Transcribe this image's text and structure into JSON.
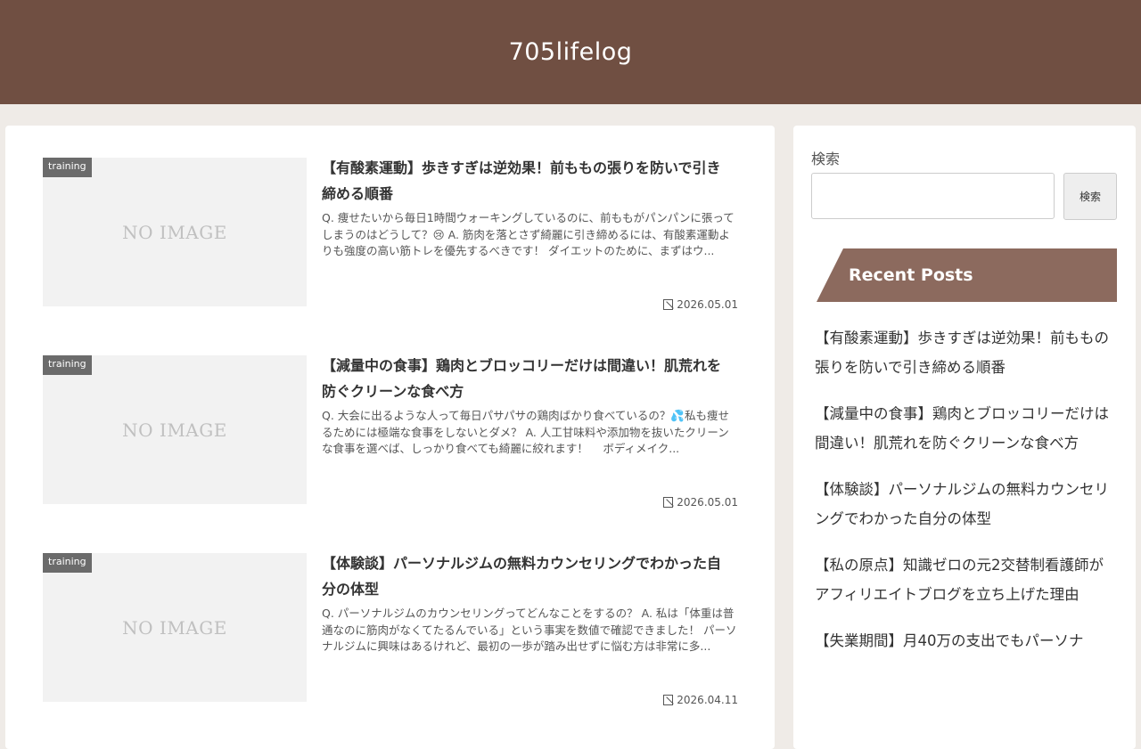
{
  "site": {
    "title": "705lifelog"
  },
  "posts": [
    {
      "category": "training",
      "thumbnail_text": "NO IMAGE",
      "title": "【有酸素運動】歩きすぎは逆効果！前ももの張りを防いで引き締める順番",
      "excerpt": "Q. 痩せたいから毎日1時間ウォーキングしているのに、前ももがパンパンに張ってしまうのはどうして？😢 A. 筋肉を落とさず綺麗に引き締めるには、有酸素運動よりも強度の高い筋トレを優先するべきです！ ダイエットのために、まずはウ...",
      "date": "2026.05.01"
    },
    {
      "category": "training",
      "thumbnail_text": "NO IMAGE",
      "title": "【減量中の食事】鶏肉とブロッコリーだけは間違い！肌荒れを防ぐクリーンな食べ方",
      "excerpt": "Q. 大会に出るような人って毎日パサパサの鶏肉ばかり食べているの？💦私も痩せるためには極端な食事をしないとダメ？ A. 人工甘味料や添加物を抜いたクリーンな食事を選べば、しっかり食べても綺麗に絞れます！ 　ボディメイク...",
      "date": "2026.05.01"
    },
    {
      "category": "training",
      "thumbnail_text": "NO IMAGE",
      "title": "【体験談】パーソナルジムの無料カウンセリングでわかった自分の体型",
      "excerpt": "Q. パーソナルジムのカウンセリングってどんなことをするの？ A. 私は「体重は普通なのに筋肉がなくてたるんでいる」という事実を数値で確認できました！ パーソナルジムに興味はあるけれど、最初の一歩が踏み出せずに悩む方は非常に多...",
      "date": "2026.04.11"
    }
  ],
  "sidebar": {
    "search_label": "検索",
    "search_placeholder": "",
    "search_button": "検索",
    "recent_title": "Recent Posts",
    "recent": [
      "【有酸素運動】歩きすぎは逆効果！前ももの張りを防いで引き締める順番",
      "【減量中の食事】鶏肉とブロッコリーだけは間違い！肌荒れを防ぐクリーンな食べ方",
      "【体験談】パーソナルジムの無料カウンセリングでわかった自分の体型",
      "【私の原点】知識ゼロの元2交替制看護師がアフィリエイトブログを立ち上げた理由",
      "【失業期間】月40万の支出でもパーソナ"
    ]
  }
}
